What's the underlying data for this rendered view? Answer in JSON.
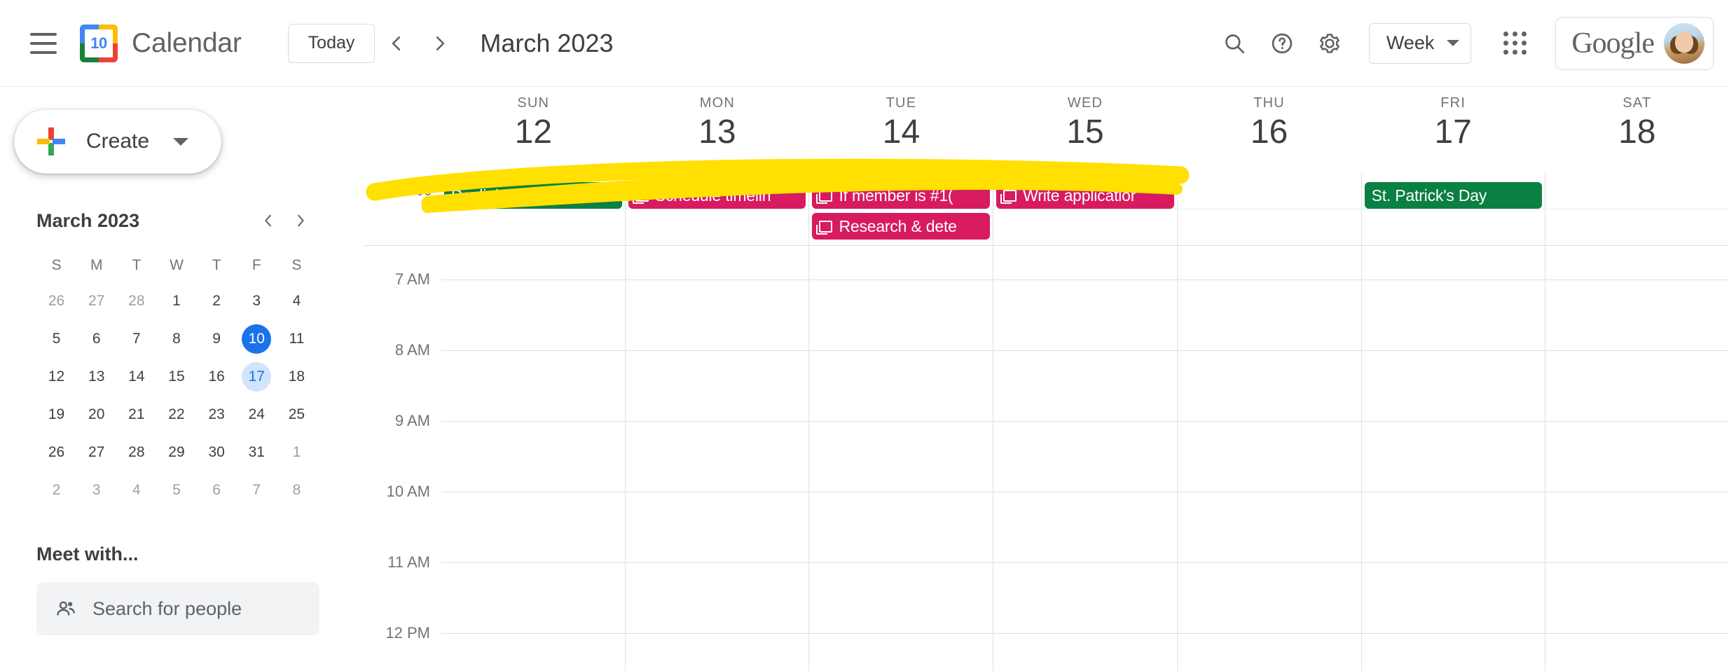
{
  "app": {
    "title": "Calendar",
    "logo_day": "10",
    "menu_icon": "hamburger-icon"
  },
  "toolbar": {
    "today_label": "Today",
    "prev_icon": "chevron-left-icon",
    "next_icon": "chevron-right-icon",
    "period_title": "March 2023",
    "search_icon": "search-icon",
    "help_icon": "help-icon",
    "settings_icon": "gear-icon",
    "view_label": "Week",
    "view_caret_icon": "chevron-down-icon",
    "apps_icon": "apps-grid-icon",
    "brand": "Google",
    "avatar": "user-avatar"
  },
  "sidebar": {
    "create_label": "Create",
    "create_caret_icon": "chevron-down-icon",
    "mini_calendar": {
      "title": "March 2023",
      "prev_icon": "chevron-left-icon",
      "next_icon": "chevron-right-icon",
      "dow": [
        "S",
        "M",
        "T",
        "W",
        "T",
        "F",
        "S"
      ],
      "weeks": [
        [
          {
            "d": "26",
            "muted": true
          },
          {
            "d": "27",
            "muted": true
          },
          {
            "d": "28",
            "muted": true
          },
          {
            "d": "1"
          },
          {
            "d": "2"
          },
          {
            "d": "3"
          },
          {
            "d": "4"
          }
        ],
        [
          {
            "d": "5"
          },
          {
            "d": "6"
          },
          {
            "d": "7"
          },
          {
            "d": "8"
          },
          {
            "d": "9"
          },
          {
            "d": "10",
            "selected": true
          },
          {
            "d": "11"
          }
        ],
        [
          {
            "d": "12"
          },
          {
            "d": "13"
          },
          {
            "d": "14"
          },
          {
            "d": "15"
          },
          {
            "d": "16"
          },
          {
            "d": "17",
            "inweek": true
          },
          {
            "d": "18"
          }
        ],
        [
          {
            "d": "19"
          },
          {
            "d": "20"
          },
          {
            "d": "21"
          },
          {
            "d": "22"
          },
          {
            "d": "23"
          },
          {
            "d": "24"
          },
          {
            "d": "25"
          }
        ],
        [
          {
            "d": "26"
          },
          {
            "d": "27"
          },
          {
            "d": "28"
          },
          {
            "d": "29"
          },
          {
            "d": "30"
          },
          {
            "d": "31"
          },
          {
            "d": "1",
            "muted": true
          }
        ],
        [
          {
            "d": "2",
            "muted": true
          },
          {
            "d": "3",
            "muted": true
          },
          {
            "d": "4",
            "muted": true
          },
          {
            "d": "5",
            "muted": true
          },
          {
            "d": "6",
            "muted": true
          },
          {
            "d": "7",
            "muted": true
          },
          {
            "d": "8",
            "muted": true
          }
        ]
      ]
    },
    "meet_with_title": "Meet with...",
    "meet_search_placeholder": "Search for people",
    "meet_search_icon": "people-icon"
  },
  "calendar": {
    "timezone_label": "GMT-06",
    "days": [
      {
        "dow": "SUN",
        "num": "12"
      },
      {
        "dow": "MON",
        "num": "13"
      },
      {
        "dow": "TUE",
        "num": "14"
      },
      {
        "dow": "WED",
        "num": "15"
      },
      {
        "dow": "THU",
        "num": "16"
      },
      {
        "dow": "FRI",
        "num": "17"
      },
      {
        "dow": "SAT",
        "num": "18"
      }
    ],
    "allday_events": [
      [
        {
          "title": "Daylight Saving Tir",
          "color": "#0b8043",
          "type": "holiday"
        }
      ],
      [
        {
          "title": "Schedule timelin",
          "color": "#d81b60",
          "type": "task"
        }
      ],
      [
        {
          "title": "If member is #1(",
          "color": "#d81b60",
          "type": "task"
        },
        {
          "title": "Research & dete",
          "color": "#d81b60",
          "type": "task"
        }
      ],
      [
        {
          "title": "Write applicatior",
          "color": "#d81b60",
          "type": "task"
        }
      ],
      [],
      [
        {
          "title": "St. Patrick's Day",
          "color": "#0b8043",
          "type": "holiday"
        }
      ],
      []
    ],
    "time_labels": [
      "7 AM",
      "8 AM",
      "9 AM",
      "10 AM",
      "11 AM",
      "12 PM"
    ],
    "annotation": {
      "kind": "highlighter-stroke",
      "color": "#FFE000"
    }
  },
  "colors": {
    "holiday_green": "#0b8043",
    "task_pink": "#d81b60",
    "accent_blue": "#1a73e8",
    "highlighter_yellow": "#FFE000"
  }
}
